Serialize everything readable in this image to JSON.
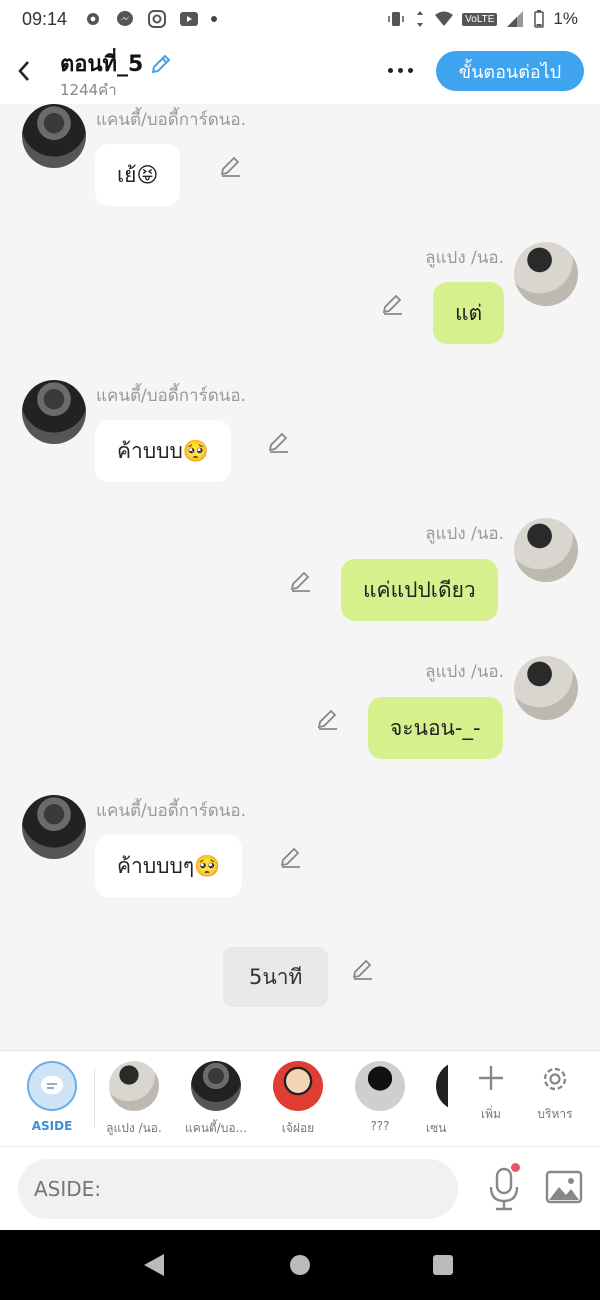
{
  "status_bar": {
    "time": "09:14",
    "network": "VoLTE",
    "battery": "1%",
    "icons": [
      "gear-icon",
      "messenger-icon",
      "instagram-icon",
      "youtube-icon",
      "dot-icon",
      "vibrate-icon",
      "data-arrows-icon",
      "wifi-icon",
      "signal-icon",
      "battery-icon"
    ]
  },
  "header": {
    "title": "ตอนที่_5",
    "word_count": "1244คำ",
    "next_button": "ขั้นตอนต่อไป",
    "icons": [
      "back-arrow-icon",
      "edit-pencil-icon",
      "more-dots-icon"
    ]
  },
  "messages": [
    {
      "sender": "แคนตี้/บอดี้การ์ดนอ.",
      "text": "เย้😝",
      "side": "left"
    },
    {
      "sender": "ลูแปง /นอ.",
      "text": "แต่",
      "side": "right"
    },
    {
      "sender": "แคนตี้/บอดี้การ์ดนอ.",
      "text": "ค้าบบบ🥺",
      "side": "left"
    },
    {
      "sender": "ลูแปง /นอ.",
      "text": "แค่แปปเดียว",
      "side": "right"
    },
    {
      "sender": "ลูแปง /นอ.",
      "text": "จะนอน-_-",
      "side": "right"
    },
    {
      "sender": "แคนตี้/บอดี้การ์ดนอ.",
      "text": "ค้าบบบๆ🥺",
      "side": "left"
    },
    {
      "sender": "",
      "text": "5นาที",
      "side": "center"
    }
  ],
  "characters": [
    {
      "label": "ASIDE"
    },
    {
      "label": "ลูแปง /นอ."
    },
    {
      "label": "แคนตี้/บอ..."
    },
    {
      "label": "เจ้ฝอย"
    },
    {
      "label": "???"
    },
    {
      "label": "เซน"
    }
  ],
  "char_actions": {
    "add": "เพิ่ม",
    "manage": "บริหาร"
  },
  "input": {
    "placeholder": "ASIDE:"
  },
  "colors": {
    "accent": "#3fa4f0",
    "green_bubble": "#d7f08e",
    "white_bubble": "#ffffff"
  }
}
